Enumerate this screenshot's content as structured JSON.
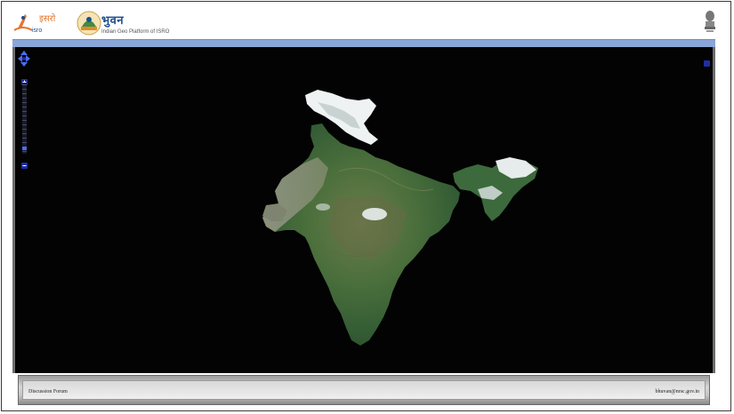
{
  "header": {
    "isro_logo_text": "इसरो",
    "isro_logo_subtext": "isro",
    "title": "भुवन",
    "subtitle": "Indian Geo Platform of ISRO"
  },
  "map": {
    "pan_icon": "pan-arrows-icon",
    "zoom_in_icon": "zoom-in-icon",
    "zoom_out_icon": "zoom-out-icon",
    "layer_switcher_icon": "layer-switcher-icon"
  },
  "footer": {
    "left_link": "Discussion Forum",
    "right_link": "bhuvan@nrsc.gov.in"
  },
  "colors": {
    "header_strip": "#8aa6d8",
    "map_background": "#030303",
    "control_blue": "#1d2fa5"
  }
}
